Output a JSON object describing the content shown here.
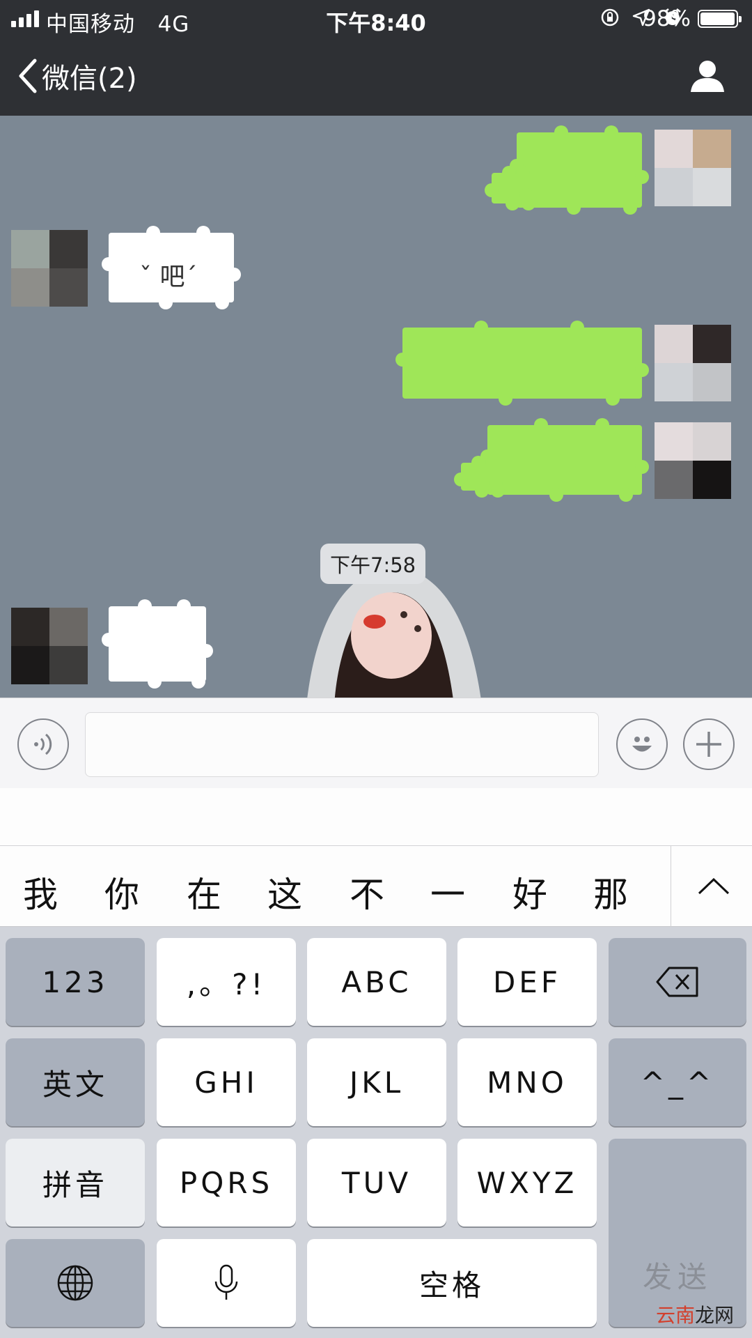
{
  "status_bar": {
    "carrier": "中国移动",
    "network": "4G",
    "time": "下午8:40",
    "battery_percent": "98%",
    "battery_level": 0.98,
    "icons": [
      "orientation-lock-icon",
      "location-icon",
      "alarm-icon"
    ]
  },
  "nav": {
    "back_label": "微信(2)",
    "back_icon": "chevron-left-icon",
    "right_icon": "person-icon"
  },
  "chat": {
    "background_color": "#7c8894",
    "sent_bubble_color": "#9fe658",
    "received_bubble_color": "#ffffff",
    "messages": [
      {
        "direction": "sent",
        "text": ""
      },
      {
        "direction": "received",
        "text": "ˇ 吧ˊ"
      },
      {
        "direction": "sent",
        "text": ""
      },
      {
        "direction": "sent",
        "text": ""
      },
      {
        "direction": "received",
        "text": ""
      }
    ],
    "timestamp": "下午7:58"
  },
  "input_bar": {
    "voice_icon": "voice-icon",
    "input_value": "",
    "emoji_icon": "emoji-icon",
    "plus_icon": "plus-icon"
  },
  "candidates": [
    "我",
    "你",
    "在",
    "这",
    "不",
    "一",
    "好",
    "那"
  ],
  "keyboard": {
    "rows": [
      [
        "123",
        ",。?!",
        "ABC",
        "DEF"
      ],
      [
        "英文",
        "GHI",
        "JKL",
        "MNO",
        "^_^"
      ],
      [
        "拼音",
        "PQRS",
        "TUV",
        "WXYZ"
      ]
    ],
    "space_label": "空格",
    "send_label": "发送",
    "delete_icon": "backspace-icon",
    "globe_icon": "globe-icon",
    "mic_icon": "microphone-icon"
  },
  "watermark": {
    "part1": "云南",
    "part2": "龙网"
  }
}
